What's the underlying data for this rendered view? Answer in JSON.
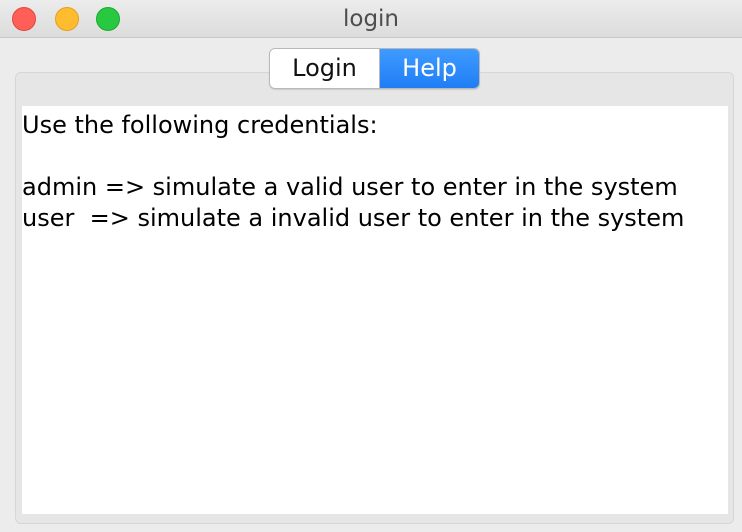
{
  "window": {
    "title": "login"
  },
  "tabs": {
    "login_label": "Login",
    "help_label": "Help",
    "selected": "Help"
  },
  "help": {
    "line1": "Use the following credentials:",
    "line2": "",
    "line3": "admin => simulate a valid user to enter in the system",
    "line4": "user  => simulate a invalid user to enter in the system"
  },
  "colors": {
    "accent": "#1f7ef5",
    "close": "#ff5f57",
    "minimize": "#febc2e",
    "zoom": "#28c840"
  }
}
